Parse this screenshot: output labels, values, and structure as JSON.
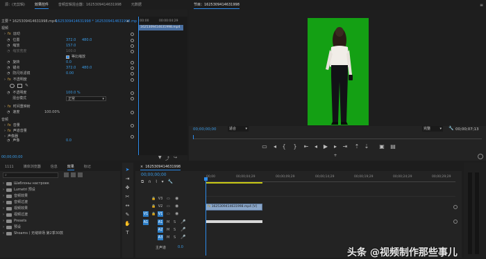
{
  "source_panel": {
    "tabs": [
      "源：(无剪辑)",
      "效果控件",
      "音频剪辑混合器：1625309414631998",
      "元数据"
    ],
    "active_tab": 1,
    "header_left": "主要 * 1625309414631998.mp4",
    "header_right": "1625309414631998 * 1625309414631998.mp4",
    "video_section": "视频",
    "motion": "运动",
    "position_label": "位置",
    "position_x": "372.0",
    "position_y": "480.0",
    "scale_label": "缩放",
    "scale_value": "157.0",
    "scale_width_label": "缩放宽度",
    "scale_width_value": "100.0",
    "uniform_scale_label": "等比缩放",
    "rotation_label": "旋转",
    "rotation_value": "0.0",
    "anchor_label": "锚点",
    "anchor_x": "372.0",
    "anchor_y": "480.0",
    "antiflicker_label": "防闪烁滤镜",
    "antiflicker_value": "0.00",
    "opacity_section": "不透明度",
    "opacity_label": "不透明度",
    "opacity_value": "100.0 %",
    "blend_label": "混合模式",
    "blend_value": "正常",
    "time_remap": "时间重映射",
    "speed_label": "速度",
    "speed_value": "100.00%",
    "audio_section": "音频",
    "volume_label": "音量",
    "channel_label": "声道音量",
    "volume_sub_label": "声像器",
    "panner_label": "声像",
    "panner_value": "0.0",
    "timeline_start": ":00:00",
    "timeline_end": "00:00:04:29",
    "clip_name": "1625309414631998.mp4",
    "timecode": "00;00;00;00"
  },
  "program_panel": {
    "title": "节目：1625309414631998",
    "timecode": "00;00;00;00",
    "fit_label": "适合",
    "quality_label": "完整",
    "duration": "00;00;07;13"
  },
  "project_panel": {
    "tabs": [
      "1111",
      "媒体浏览器",
      "信息",
      "效果",
      "标记"
    ],
    "active_tab": 3,
    "items": [
      "Шаблоны настроек",
      "Lumetri 预设",
      "音频效果",
      "音频过渡",
      "视频效果",
      "视频过渡",
      "Presets",
      "预设",
      "Shoams丨无缝转场 第2季30款"
    ]
  },
  "timeline_panel": {
    "tab_label": "1625309414631998",
    "timecode": "00;00;00;00",
    "ruler": [
      "00;00",
      "00;00;04;29",
      "00;00;09;29",
      "00;00;14;29",
      "00;00;19;29",
      "00;00;24;29",
      "00;00;29;29"
    ],
    "video_tracks": [
      "V3",
      "V2",
      "V1"
    ],
    "audio_tracks": [
      "A1",
      "A2",
      "A3"
    ],
    "master_label": "主声道",
    "master_value": "0.0",
    "clip_label": "1625309414631998.mp4 [V]"
  },
  "watermark": "头条 @视频制作那些事儿",
  "colors": {
    "accent": "#2d8ceb",
    "green_screen": "#14a014",
    "clip_video": "#8aa6c8",
    "playhead": "#2d8ceb"
  }
}
